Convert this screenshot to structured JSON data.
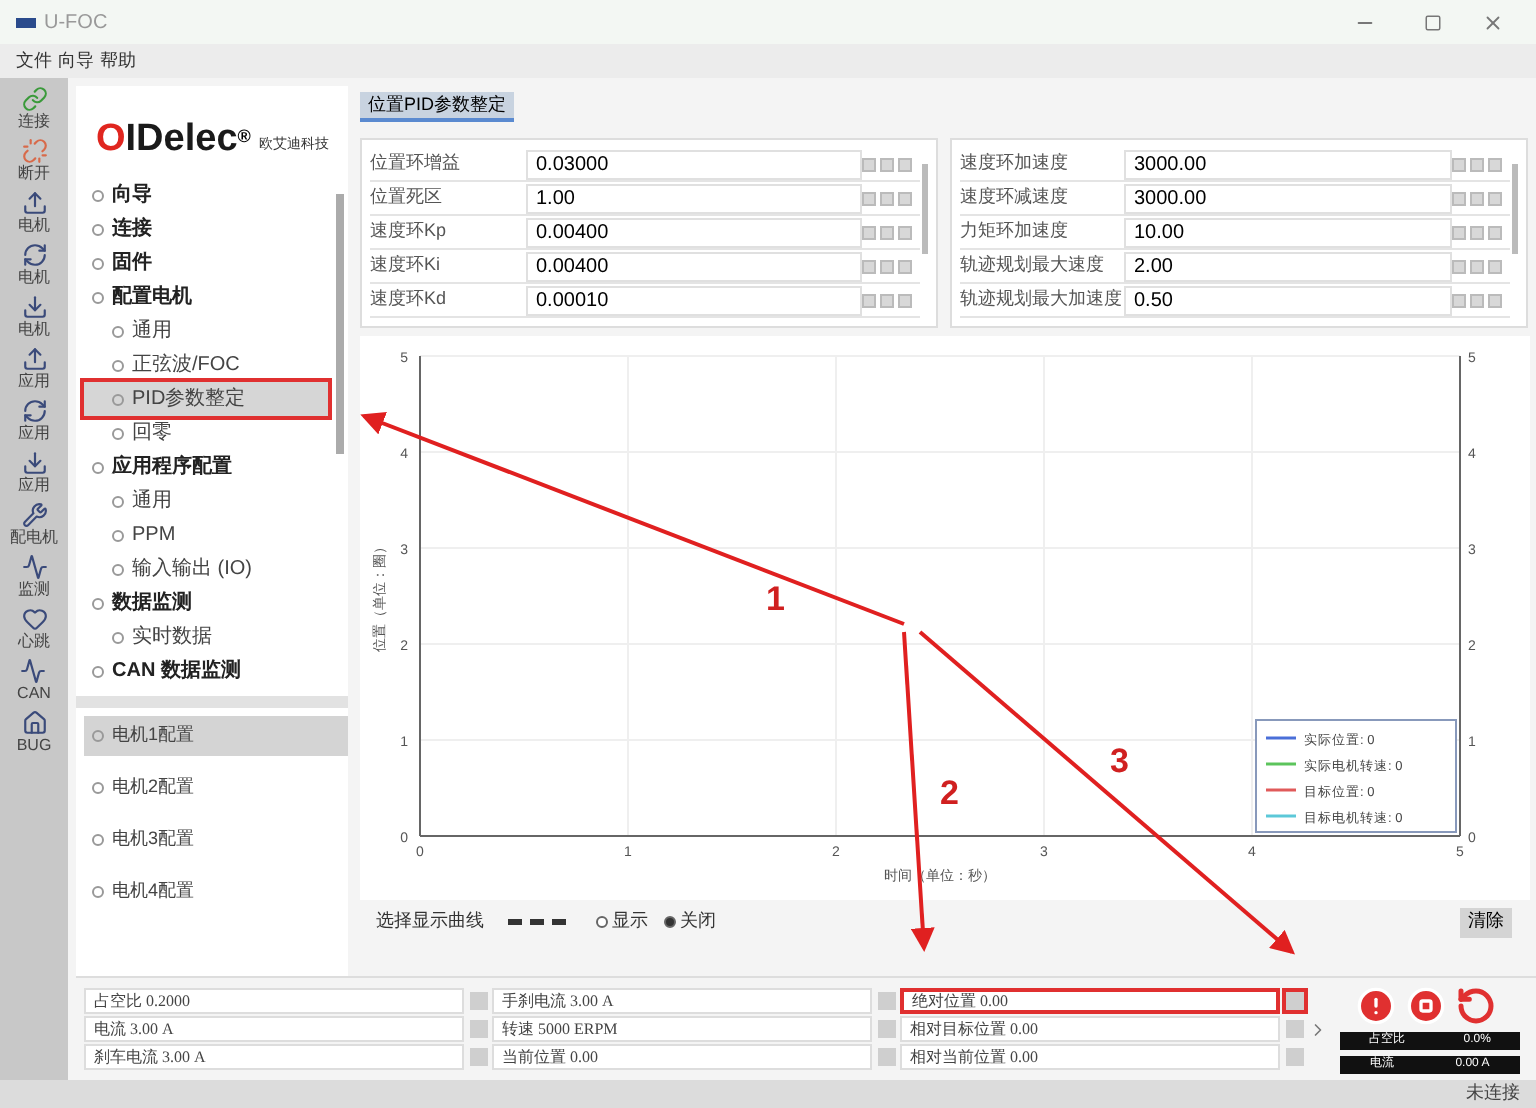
{
  "window": {
    "title": "U-FOC"
  },
  "menu": [
    "文件",
    "向导",
    "帮助"
  ],
  "toolbar": [
    {
      "label": "连接",
      "kind": "link"
    },
    {
      "label": "断开",
      "kind": "unlink"
    },
    {
      "label": "电机",
      "kind": "upload"
    },
    {
      "label": "电机",
      "kind": "sync"
    },
    {
      "label": "电机",
      "kind": "download"
    },
    {
      "label": "应用",
      "kind": "upload"
    },
    {
      "label": "应用",
      "kind": "sync"
    },
    {
      "label": "应用",
      "kind": "download"
    },
    {
      "label": "配电机",
      "kind": "config"
    },
    {
      "label": "监测",
      "kind": "monitor"
    },
    {
      "label": "心跳",
      "kind": "heart"
    },
    {
      "label": "CAN",
      "kind": "wave"
    },
    {
      "label": "BUG",
      "kind": "home"
    }
  ],
  "logo": {
    "brand": "OIDelec",
    "mark": "®",
    "company": "欧艾迪科技"
  },
  "tree": [
    {
      "label": "向导",
      "selected": false,
      "highlighted": false
    },
    {
      "label": "连接",
      "selected": false,
      "highlighted": false
    },
    {
      "label": "固件",
      "selected": false,
      "highlighted": false
    },
    {
      "label": "配置电机",
      "selected": false,
      "highlighted": false,
      "children": [
        {
          "label": "通用",
          "selected": false,
          "highlighted": false
        },
        {
          "label": "正弦波/FOC",
          "selected": false,
          "highlighted": false
        },
        {
          "label": "PID参数整定",
          "selected": true,
          "highlighted": true
        },
        {
          "label": "回零",
          "selected": false,
          "highlighted": false
        }
      ]
    },
    {
      "label": "应用程序配置",
      "selected": false,
      "highlighted": false,
      "children": [
        {
          "label": "通用",
          "selected": false,
          "highlighted": false
        },
        {
          "label": "PPM",
          "selected": false,
          "highlighted": false
        },
        {
          "label": "输入输出 (IO)",
          "selected": false,
          "highlighted": false
        }
      ]
    },
    {
      "label": "数据监测",
      "selected": false,
      "highlighted": false,
      "children": [
        {
          "label": "实时数据",
          "selected": false,
          "highlighted": false
        }
      ]
    },
    {
      "label": "CAN 数据监测",
      "selected": false,
      "highlighted": false
    }
  ],
  "motors": [
    {
      "label": "电机1配置",
      "selected": true
    },
    {
      "label": "电机2配置",
      "selected": false
    },
    {
      "label": "电机3配置",
      "selected": false
    },
    {
      "label": "电机4配置",
      "selected": false
    }
  ],
  "tabs": [
    {
      "label": "位置PID参数整定",
      "selected": true
    }
  ],
  "params_left": [
    {
      "name": "位置环增益",
      "value": "0.03000"
    },
    {
      "name": "位置死区",
      "value": "1.00"
    },
    {
      "name": "速度环Kp",
      "value": "0.00400"
    },
    {
      "name": "速度环Ki",
      "value": "0.00400"
    },
    {
      "name": "速度环Kd",
      "value": "0.00010"
    }
  ],
  "params_right": [
    {
      "name": "速度环加速度",
      "value": "3000.00"
    },
    {
      "name": "速度环减速度",
      "value": "3000.00"
    },
    {
      "name": "力矩环加速度",
      "value": "10.00"
    },
    {
      "name": "轨迹规划最大速度",
      "value": "2.00"
    },
    {
      "name": "轨迹规划最大加速度",
      "value": "0.50"
    }
  ],
  "chart": {
    "chart_data": {
      "type": "line",
      "xlabel": "时间（单位：秒）",
      "ylabel": "位置（单位：圈）",
      "categories": [
        "0",
        "1",
        "2",
        "3",
        "4",
        "5"
      ],
      "ylim": [
        0,
        5
      ],
      "yticks": [
        0,
        1,
        2,
        3,
        4,
        5
      ],
      "y2ticks": [
        0,
        1,
        2,
        3,
        4,
        5
      ],
      "y2lim": [
        0,
        5
      ],
      "grid": true,
      "series": [
        {
          "name": "实际位置: 0",
          "color": "#4a6fd8",
          "values": [
            null,
            null,
            null,
            null,
            null,
            null
          ]
        },
        {
          "name": "实际电机转速: 0",
          "color": "#5cc45c",
          "values": [
            null,
            null,
            null,
            null,
            null,
            null
          ]
        },
        {
          "name": "目标位置: 0",
          "color": "#e05a5a",
          "values": [
            null,
            null,
            null,
            null,
            null,
            null
          ]
        },
        {
          "name": "目标电机转速: 0",
          "color": "#5cc8d8",
          "values": [
            null,
            null,
            null,
            null,
            null,
            null
          ]
        }
      ]
    }
  },
  "curve_select": {
    "label": "选择显示曲线",
    "options": [
      {
        "label": "显示",
        "selected": false
      },
      {
        "label": "关闭",
        "selected": true
      }
    ],
    "clear_button": "清除"
  },
  "status_fields": [
    [
      {
        "text": "占空比 0.2000",
        "highlighted": false
      },
      {
        "text": "电流 3.00 A",
        "highlighted": false
      },
      {
        "text": "刹车电流 3.00 A",
        "highlighted": false
      }
    ],
    [
      {
        "text": "手刹电流 3.00 A",
        "highlighted": false
      },
      {
        "text": "转速 5000 ERPM",
        "highlighted": false
      },
      {
        "text": "当前位置 0.00",
        "highlighted": false
      }
    ],
    [
      {
        "text": "绝对位置 0.00",
        "highlighted": true
      },
      {
        "text": "相对目标位置 0.00",
        "highlighted": false
      },
      {
        "text": "相对当前位置 0.00",
        "highlighted": false
      }
    ]
  ],
  "meters": [
    {
      "label": "占空比",
      "reading": "0.0%"
    },
    {
      "label": "电流",
      "reading": "0.00 A"
    }
  ],
  "annotations": [
    "1",
    "2",
    "3"
  ],
  "status_bar": "未连接"
}
